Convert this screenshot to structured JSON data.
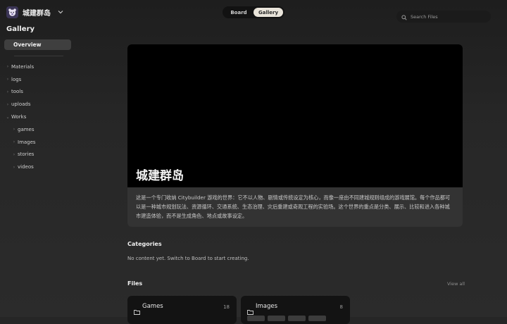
{
  "workspace": {
    "name": "城建群岛",
    "logo_icon": "bear-avatar-icon"
  },
  "sidebar": {
    "section_title": "Gallery",
    "overview_label": "Overview",
    "tree": [
      {
        "label": "Materials",
        "level": 0
      },
      {
        "label": "logs",
        "level": 0
      },
      {
        "label": "tools",
        "level": 0
      },
      {
        "label": "uploads",
        "level": 0
      },
      {
        "label": "Works",
        "level": 0,
        "expanded": true
      },
      {
        "label": "games",
        "level": 1
      },
      {
        "label": "Images",
        "level": 1
      },
      {
        "label": "stories",
        "level": 1
      },
      {
        "label": "videos",
        "level": 1
      }
    ]
  },
  "view_switch": {
    "board": "Board",
    "gallery": "Gallery",
    "active": "Gallery"
  },
  "search": {
    "placeholder": "Search Files"
  },
  "hero": {
    "title": "城建群岛",
    "description": "这是一个专门收纳 Citybuilder 游戏的世界：它不以人物、剧情或传统设定为核心，而像一座由不同建城规则组成的游戏展馆。每个作品都可以是一种城市规划玩法、资源循环、交通系统、生态治理、灾后重建或奇观工程的实验场。这个世界的重点是分类、展示、比较和进入各种城市建造体验，而不是生成角色、地点或故事设定。"
  },
  "categories": {
    "title": "Categories",
    "empty_text": "No content yet. Switch to Board to start creating."
  },
  "files": {
    "title": "Files",
    "view_all": "View all",
    "cards": [
      {
        "name": "Games",
        "count": "18"
      },
      {
        "name": "Images",
        "count": "8"
      }
    ]
  },
  "colors": {
    "accent_active_tab": "#e9e4da",
    "background": "#262626",
    "card": "#131313"
  }
}
